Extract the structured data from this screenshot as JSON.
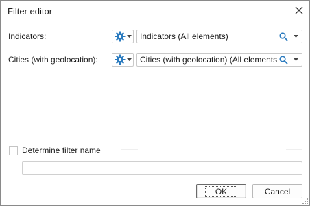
{
  "window": {
    "title": "Filter editor"
  },
  "rows": [
    {
      "label": "Indicators:",
      "value": "Indicators (All elements)"
    },
    {
      "label": "Cities (with geolocation):",
      "value": "Cities (with geolocation) (All elements)"
    }
  ],
  "filter_name": {
    "checkbox_label": "Determine filter name",
    "checked": false,
    "value": ""
  },
  "buttons": {
    "ok": "OK",
    "cancel": "Cancel"
  },
  "colors": {
    "gear": "#2b7bbf",
    "search": "#2b7bbf",
    "border": "#c9c9c9"
  },
  "icons": [
    "close-icon",
    "gear-icon",
    "search-icon",
    "chevron-down-icon",
    "resize-grip-icon"
  ]
}
